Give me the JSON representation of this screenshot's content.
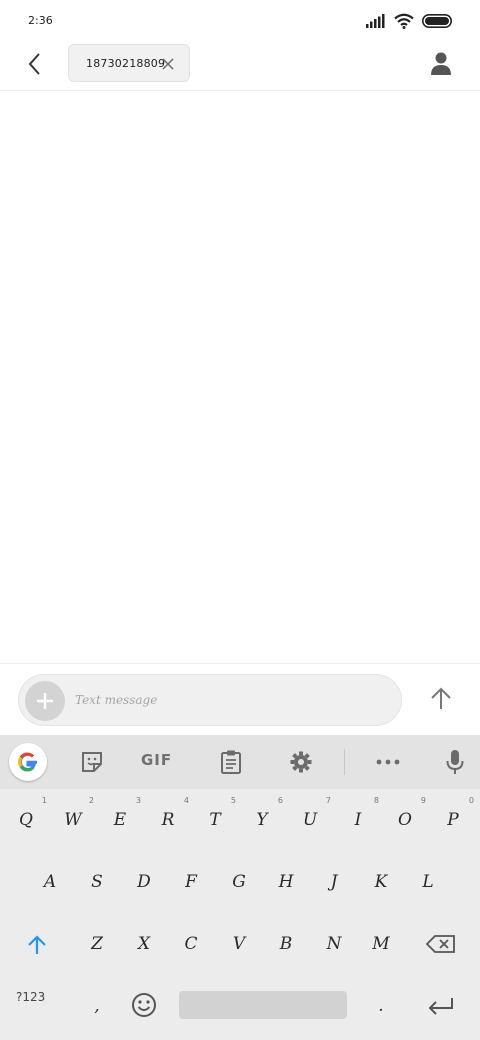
{
  "status_bar": {
    "time": "2:36"
  },
  "header": {
    "recipient_chip": {
      "label": "18730218809"
    }
  },
  "composer": {
    "placeholder": "Text message",
    "value": ""
  },
  "keyboard": {
    "toolbar": {
      "gif_label": "GIF"
    },
    "rows": [
      [
        {
          "label": "Q",
          "hint": "1"
        },
        {
          "label": "W",
          "hint": "2"
        },
        {
          "label": "E",
          "hint": "3"
        },
        {
          "label": "R",
          "hint": "4"
        },
        {
          "label": "T",
          "hint": "5"
        },
        {
          "label": "Y",
          "hint": "6"
        },
        {
          "label": "U",
          "hint": "7"
        },
        {
          "label": "I",
          "hint": "8"
        },
        {
          "label": "O",
          "hint": "9"
        },
        {
          "label": "P",
          "hint": "0"
        }
      ],
      [
        {
          "label": "A"
        },
        {
          "label": "S"
        },
        {
          "label": "D"
        },
        {
          "label": "F"
        },
        {
          "label": "G"
        },
        {
          "label": "H"
        },
        {
          "label": "J"
        },
        {
          "label": "K"
        },
        {
          "label": "L"
        }
      ],
      [
        {
          "label": "Z"
        },
        {
          "label": "X"
        },
        {
          "label": "C"
        },
        {
          "label": "V"
        },
        {
          "label": "B"
        },
        {
          "label": "N"
        },
        {
          "label": "M"
        }
      ],
      [
        {
          "label": "?123"
        },
        {
          "label": ","
        },
        {
          "label": "."
        }
      ]
    ],
    "icons": [
      "google-icon",
      "sticker-icon",
      "clipboard-icon",
      "gear-icon",
      "more-icon",
      "microphone-icon",
      "shift-icon",
      "backspace-icon",
      "emoji-icon",
      "enter-icon"
    ]
  },
  "colors": {
    "accent": "#2196f3",
    "icon_gray": "#6b6b6b",
    "keyboard_bg": "#ececec",
    "toolbar_bg": "#e3e3e3"
  }
}
